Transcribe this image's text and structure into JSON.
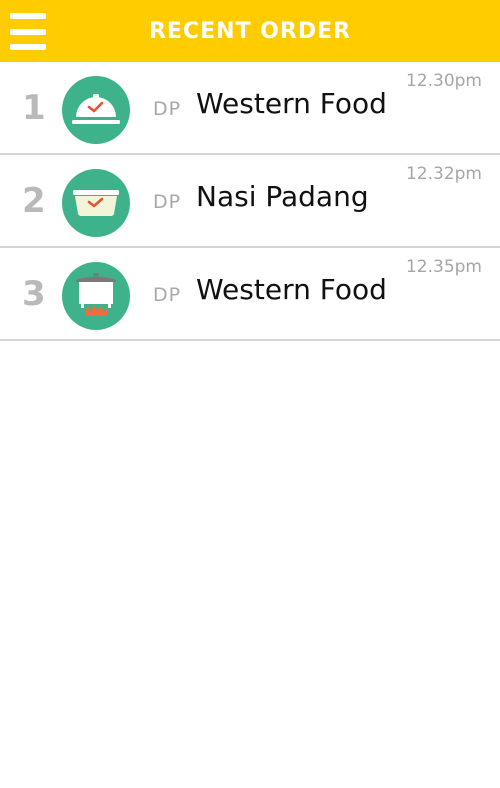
{
  "header": {
    "title": "RECENT ORDER",
    "menu_icon": "hamburger-menu-icon",
    "background_color": "#ffcc00"
  },
  "orders": [
    {
      "index": "1",
      "icon": "food-cloche-icon",
      "code": "DP",
      "name": "Western Food",
      "time": "12.30pm"
    },
    {
      "index": "2",
      "icon": "food-bowl-icon",
      "code": "DP",
      "name": "Nasi Padang",
      "time": "12.32pm"
    },
    {
      "index": "3",
      "icon": "cooking-pot-icon",
      "code": "DP",
      "name": "Western Food",
      "time": "12.35pm"
    }
  ],
  "colors": {
    "accent": "#ffcc00",
    "icon_circle": "#3db28b",
    "check_mark": "#e8523a",
    "flame": "#f26b3a"
  }
}
